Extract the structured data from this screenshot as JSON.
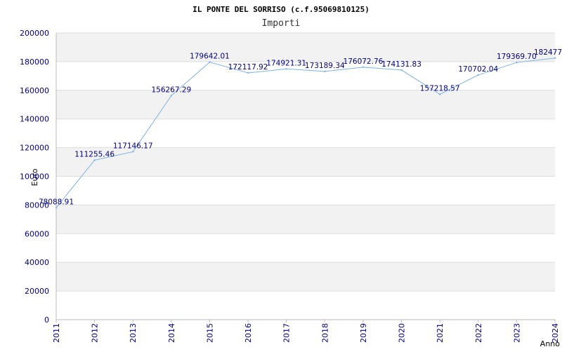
{
  "chart_data": {
    "type": "line",
    "title": "IL PONTE DEL SORRISO (c.f.95069810125)",
    "subtitle": "Importi",
    "xlabel": "Anno",
    "ylabel": "Euro",
    "ylim": [
      0,
      200000
    ],
    "y_ticks": [
      "0",
      "20000",
      "40000",
      "60000",
      "80000",
      "100000",
      "120000",
      "140000",
      "160000",
      "180000",
      "200000"
    ],
    "x": [
      "2011",
      "2012",
      "2013",
      "2014",
      "2015",
      "2016",
      "2017",
      "2018",
      "2019",
      "2020",
      "2021",
      "2022",
      "2023",
      "2024"
    ],
    "series": [
      {
        "values": [
          78088.91,
          111255.46,
          117146.17,
          156267.29,
          179642.01,
          172117.92,
          174921.31,
          173189.34,
          176072.76,
          174131.83,
          157218.57,
          170702.04,
          179369.7,
          182477
        ],
        "labels": [
          "78088.91",
          "111255.46",
          "117146.17",
          "156267.29",
          "179642.01",
          "172117.92",
          "174921.31",
          "173189.34",
          "176072.76",
          "174131.83",
          "157218.57",
          "170702.04",
          "179369.70",
          "182477"
        ]
      }
    ],
    "grid": true,
    "colors": {
      "line": "#7fb2e5",
      "band": "#f2f2f2",
      "gridline": "#dddddd",
      "axis": "#bbbbbb",
      "tick_text": "#000080",
      "label_text": "#000080"
    }
  }
}
